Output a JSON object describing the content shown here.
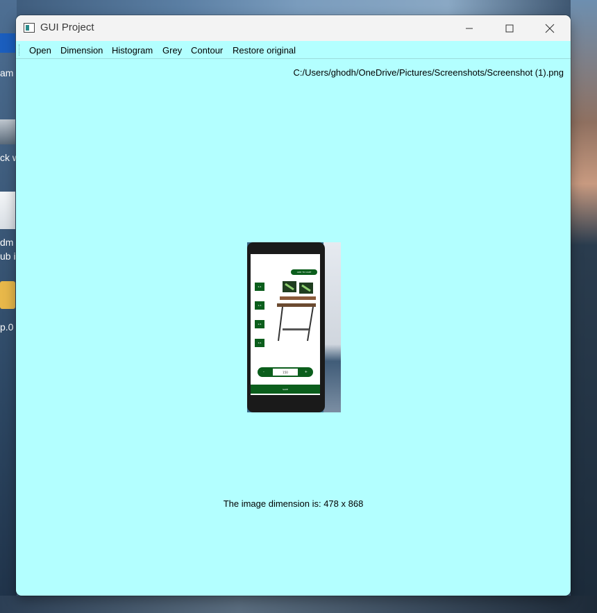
{
  "window": {
    "title": "GUI Project",
    "background_color": "#b3ffff"
  },
  "titlebar_buttons": {
    "minimize_icon": "minimize-icon",
    "maximize_icon": "maximize-icon",
    "close_icon": "close-icon"
  },
  "menu": {
    "items": [
      "Open",
      "Dimension",
      "Histogram",
      "Grey",
      "Contour",
      "Restore original"
    ]
  },
  "file_path": "C:/Users/ghodh/OneDrive/Pictures/Screenshots/Screenshot (1).png",
  "dimension_text": "The image dimension is: 478 x 868",
  "desktop": {
    "labels": [
      "am",
      "ck w",
      "dm",
      "ub i",
      "p.0"
    ]
  },
  "preview_phone": {
    "top_button": "ADD TO CART",
    "sizes": [
      "2-4",
      "1-3",
      "2-5",
      "3-5"
    ],
    "stepper_minus": "-",
    "stepper_value": "150",
    "stepper_plus": "+",
    "bottom_button": "SAVE",
    "accent_color": "#0b5e1c"
  }
}
